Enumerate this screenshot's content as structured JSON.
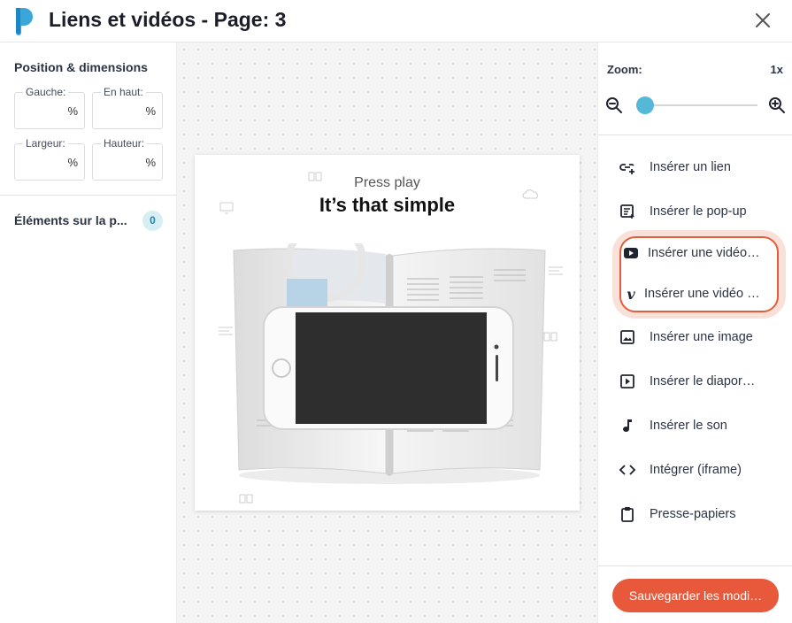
{
  "header": {
    "title": "Liens et vidéos - Page: 3"
  },
  "left_panel": {
    "section_title": "Position & dimensions",
    "fields": [
      {
        "label": "Gauche:",
        "value": "",
        "unit": "%"
      },
      {
        "label": "En haut:",
        "value": "",
        "unit": "%"
      },
      {
        "label": "Largeur:",
        "value": "",
        "unit": "%"
      },
      {
        "label": "Hauteur:",
        "value": "",
        "unit": "%"
      }
    ],
    "elements_title": "Éléments sur la p...",
    "elements_count": "0"
  },
  "canvas": {
    "press_play": "Press play",
    "headline": "It’s that simple"
  },
  "right_panel": {
    "zoom_label": "Zoom:",
    "zoom_value": "1x",
    "zoom_level": 0.05,
    "menu": [
      {
        "label": "Insérer un lien",
        "icon": "link-add-icon"
      },
      {
        "label": "Insérer le pop-up",
        "icon": "popup-icon"
      },
      {
        "label": "Insérer une vidéo…",
        "icon": "youtube-icon"
      },
      {
        "label": "Insérer une vidéo …",
        "icon": "vimeo-icon"
      },
      {
        "label": "Insérer une image",
        "icon": "image-icon"
      },
      {
        "label": "Insérer le diapor…",
        "icon": "slideshow-icon"
      },
      {
        "label": "Insérer le son",
        "icon": "music-note-icon"
      },
      {
        "label": "Intégrer (iframe)",
        "icon": "code-icon"
      },
      {
        "label": "Presse-papiers",
        "icon": "clipboard-icon"
      }
    ],
    "save_label": "Sauvegarder les modi…"
  },
  "colors": {
    "accent": "#e8583a",
    "highlight_border": "#e35d3b",
    "slider_thumb": "#55b8d6",
    "logo": "#3aa6d9"
  }
}
